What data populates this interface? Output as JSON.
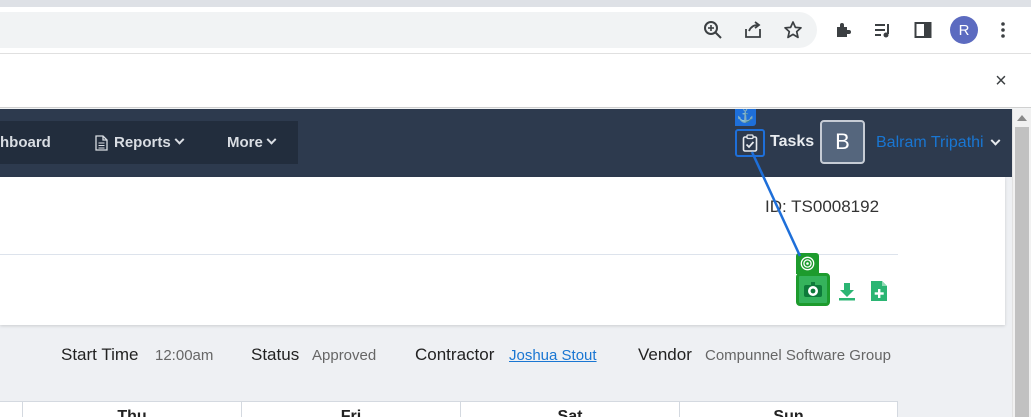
{
  "browser": {
    "profile_initial": "R",
    "icons": [
      "zoom-icon",
      "share-icon",
      "bookmark-star-icon",
      "extensions-icon",
      "media-queue-icon",
      "side-panel-icon",
      "more-menu-icon"
    ]
  },
  "infobar": {
    "close_label": "×"
  },
  "nav": {
    "dashboard_label": "hboard",
    "reports_label": "Reports",
    "more_label": "More",
    "tasks_label": "Tasks",
    "user_initial": "B",
    "user_name": "Balram Tripathi"
  },
  "timesheet": {
    "id_text": "ID: TS0008192"
  },
  "details": {
    "start_time_label": "Start Time",
    "start_time_value": "12:00am",
    "status_label": "Status",
    "status_value": "Approved",
    "contractor_label": "Contractor",
    "contractor_value": "Joshua Stout",
    "vendor_label": "Vendor",
    "vendor_value": "Compunnel Software Group"
  },
  "table": {
    "columns": [
      "Thu",
      "Fri",
      "Sat",
      "Sun"
    ]
  },
  "colors": {
    "nav_bg": "#2d3a4e",
    "accent_blue": "#1976d2",
    "action_green": "#2bb573",
    "highlight_green": "#1d9b2d",
    "highlight_blue": "#1e6fd9"
  }
}
